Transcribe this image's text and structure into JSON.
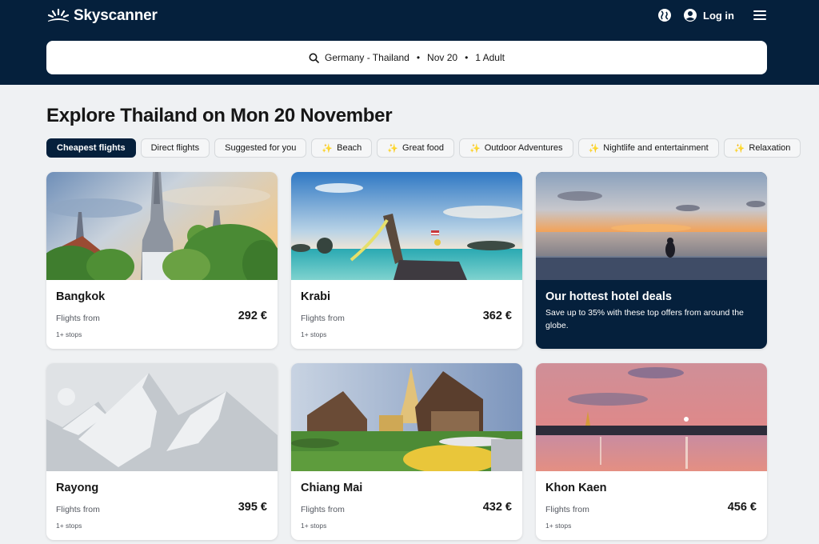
{
  "header": {
    "brand": "Skyscanner",
    "logo_icon": "sunrise-icon",
    "globe_icon": "globe-icon",
    "account_icon": "user-circle-icon",
    "login_label": "Log in",
    "menu_icon": "hamburger-menu-icon",
    "colors": {
      "background": "#05203c",
      "text": "#ffffff"
    }
  },
  "search": {
    "icon": "search-icon",
    "route": "Germany - Thailand",
    "date": "Nov 20",
    "travellers": "1 Adult",
    "separator": "•"
  },
  "page": {
    "title": "Explore Thailand on Mon 20 November"
  },
  "filters": [
    {
      "label": "Cheapest flights",
      "active": true,
      "sparkle": false
    },
    {
      "label": "Direct flights",
      "active": false,
      "sparkle": false
    },
    {
      "label": "Suggested for you",
      "active": false,
      "sparkle": false
    },
    {
      "label": "Beach",
      "active": false,
      "sparkle": true
    },
    {
      "label": "Great food",
      "active": false,
      "sparkle": true
    },
    {
      "label": "Outdoor Adventures",
      "active": false,
      "sparkle": true
    },
    {
      "label": "Nightlife and entertainment",
      "active": false,
      "sparkle": true
    },
    {
      "label": "Relaxation",
      "active": false,
      "sparkle": true
    }
  ],
  "sparkle_glyph": "✨",
  "destinations": [
    {
      "city": "Bangkok",
      "flights_from_label": "Flights from",
      "price": "292 €",
      "stops": "1+ stops",
      "image": "temple-skyline-photo"
    },
    {
      "city": "Krabi",
      "flights_from_label": "Flights from",
      "price": "362 €",
      "stops": "1+ stops",
      "image": "longtail-boat-beach-photo"
    },
    {
      "city": "Rayong",
      "flights_from_label": "Flights from",
      "price": "395 €",
      "stops": "1+ stops",
      "image": "mountain-placeholder-image"
    },
    {
      "city": "Chiang Mai",
      "flights_from_label": "Flights from",
      "price": "432 €",
      "stops": "1+ stops",
      "image": "wat-phra-singh-photo"
    },
    {
      "city": "Khon Kaen",
      "flights_from_label": "Flights from",
      "price": "456 €",
      "stops": "1+ stops",
      "image": "lake-sunset-photo"
    }
  ],
  "promo": {
    "title": "Our hottest hotel deals",
    "text": "Save up to 35% with these top offers from around the globe.",
    "image": "infinity-pool-sunset-photo"
  }
}
